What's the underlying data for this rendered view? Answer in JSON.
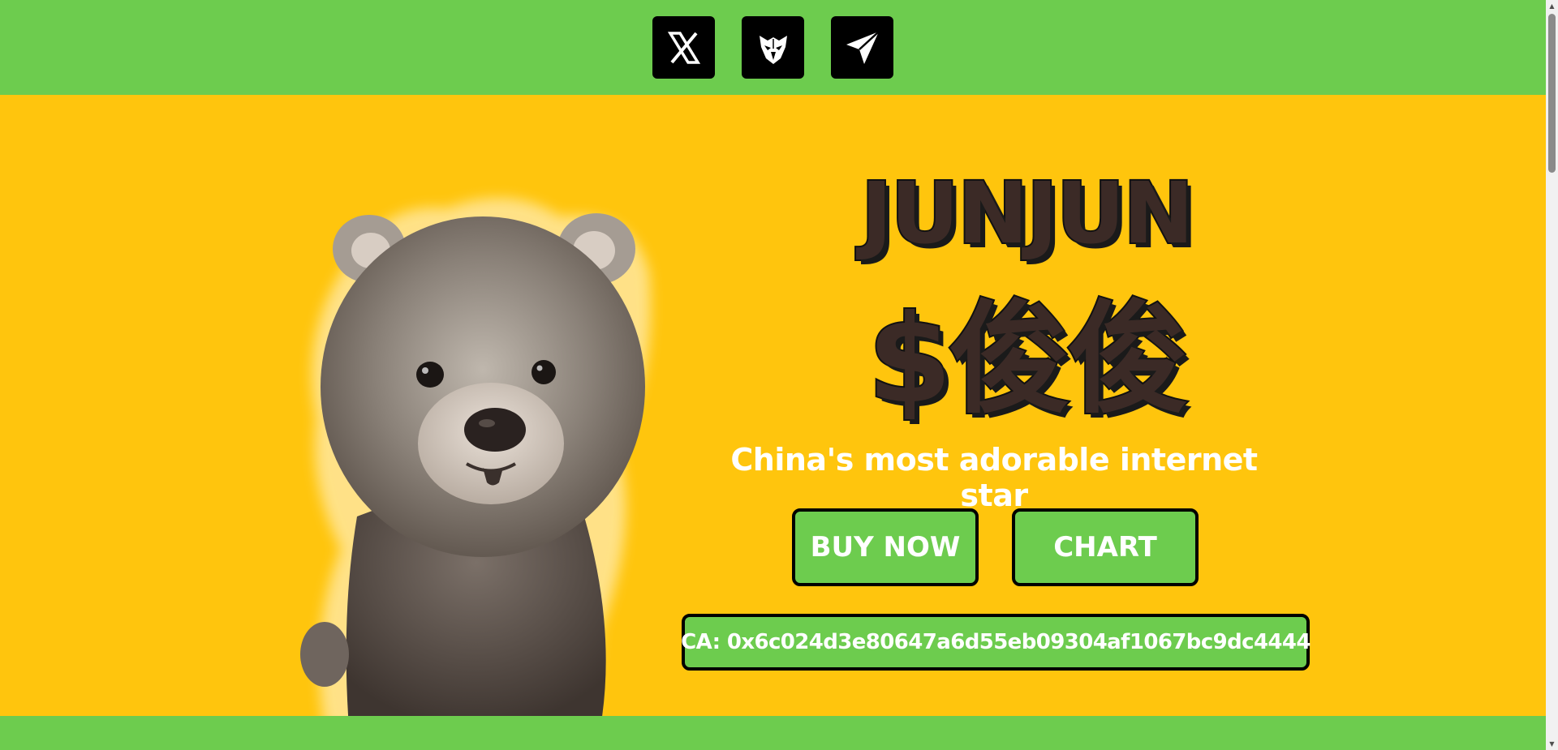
{
  "social": {
    "x_icon": "x-logo-icon",
    "eagle_icon": "eagle-icon",
    "telegram_icon": "telegram-icon"
  },
  "hero": {
    "logo_line1": "JUNJUN",
    "logo_line2": "$俊俊",
    "tagline": "China's most adorable internet star",
    "buy_label": "BUY NOW",
    "chart_label": "CHART",
    "contract": "CA: 0x6c024d3e80647a6d55eb09304af1067bc9dc4444"
  },
  "colors": {
    "green": "#6dcc4e",
    "yellow": "#ffc50d",
    "logo_dark": "#3b2a26",
    "logo_light": "#d8bfb3"
  }
}
